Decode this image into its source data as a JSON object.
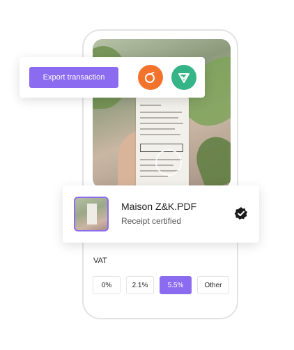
{
  "export": {
    "button_label": "Export transaction",
    "apps": [
      {
        "icon": "orange-app-icon",
        "color": "#f3732d"
      },
      {
        "icon": "green-app-icon",
        "color": "#35b488"
      }
    ]
  },
  "file": {
    "name": "Maison Z&K.PDF",
    "status": "Receipt certified",
    "badge_icon": "verified-check-icon"
  },
  "vat": {
    "label": "VAT",
    "options": [
      "0%",
      "2.1%",
      "5.5%",
      "Other"
    ],
    "selected_index": 2
  },
  "colors": {
    "accent": "#8b6cf0"
  }
}
